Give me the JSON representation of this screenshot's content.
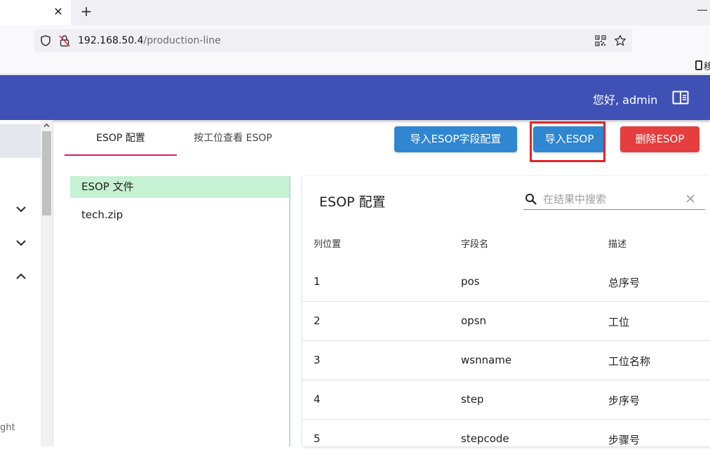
{
  "browser": {
    "url_host": "192.168.50.4",
    "url_path": "/production-line",
    "bookmark_label": "移"
  },
  "header": {
    "greeting": "您好, admin"
  },
  "sidebar": {
    "footer_text": "ght"
  },
  "tabs": [
    {
      "label": "ESOP 配置",
      "active": true
    },
    {
      "label": "按工位查看 ESOP",
      "active": false
    }
  ],
  "actions": {
    "field_config": "导入ESOP字段配置",
    "import": "导入ESOP",
    "delete": "删除ESOP"
  },
  "files": {
    "header": "ESOP 文件",
    "items": [
      "tech.zip"
    ]
  },
  "config": {
    "title": "ESOP 配置",
    "search_placeholder": "在结果中搜索",
    "columns": [
      "列位置",
      "字段名",
      "描述"
    ],
    "rows": [
      [
        "1",
        "pos",
        "总序号"
      ],
      [
        "2",
        "opsn",
        "工位"
      ],
      [
        "3",
        "wsnname",
        "工位名称"
      ],
      [
        "4",
        "step",
        "步序号"
      ],
      [
        "5",
        "stepcode",
        "步骤号"
      ]
    ]
  },
  "colors": {
    "appbar": "#3f51b5",
    "primary_button": "#2f86d1",
    "danger_button": "#e53e3e",
    "tab_indicator": "#d81b60",
    "file_header_bg": "#c6f1d3",
    "annotation": "#e3242b"
  }
}
